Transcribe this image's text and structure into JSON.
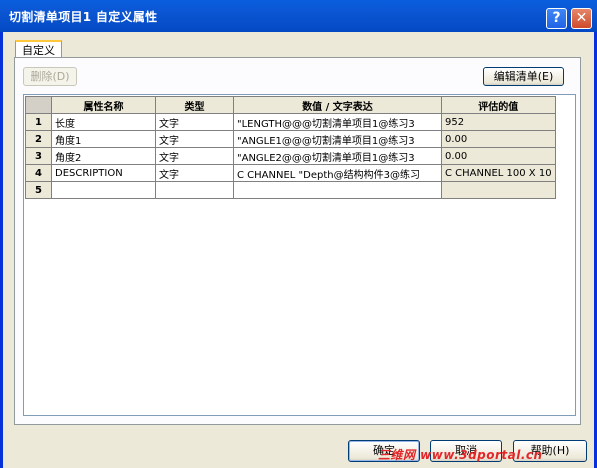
{
  "window": {
    "title": "切割清单项目1 自定义属性",
    "help_glyph": "?",
    "close_glyph": "✕"
  },
  "tab": {
    "label": "自定义"
  },
  "toolbar": {
    "delete_label": "删除(D)",
    "edit_list_label": "编辑清单(E)"
  },
  "grid": {
    "headers": [
      "属性名称",
      "类型",
      "数值 / 文字表达",
      "评估的值"
    ],
    "rows": [
      {
        "num": "1",
        "name": "长度",
        "type": "文字",
        "expr": "\"LENGTH@@@切割清单项目1@练习3",
        "value": "952"
      },
      {
        "num": "2",
        "name": "角度1",
        "type": "文字",
        "expr": "\"ANGLE1@@@切割清单项目1@练习3",
        "value": "0.00"
      },
      {
        "num": "3",
        "name": "角度2",
        "type": "文字",
        "expr": "\"ANGLE2@@@切割清单项目1@练习3",
        "value": "0.00"
      },
      {
        "num": "4",
        "name": "DESCRIPTION",
        "type": "文字",
        "expr": "C CHANNEL \"Depth@结构构件3@练习",
        "value": "C CHANNEL 100 X 10"
      },
      {
        "num": "5",
        "name": "",
        "type": "",
        "expr": "",
        "value": ""
      }
    ]
  },
  "footer": {
    "ok_label": "确定",
    "cancel_label": "取消",
    "help_label": "帮助(H)"
  },
  "watermark": {
    "text": "三维网 www.3dportal.cn"
  }
}
